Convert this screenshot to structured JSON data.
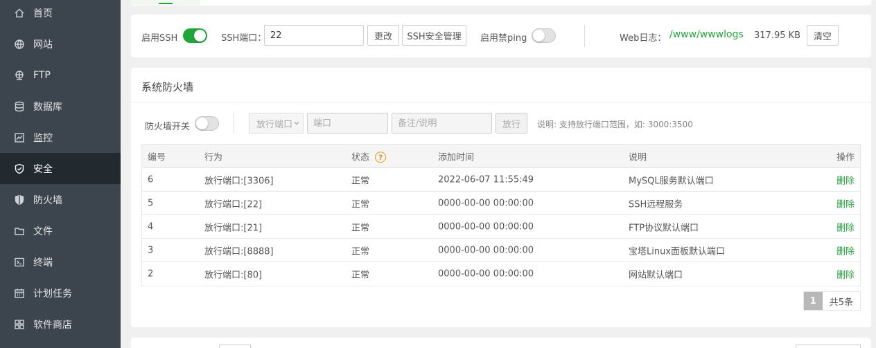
{
  "sidebar": {
    "items": [
      {
        "label": "首页",
        "icon": "home-icon"
      },
      {
        "label": "网站",
        "icon": "globe-icon"
      },
      {
        "label": "FTP",
        "icon": "ftp-icon"
      },
      {
        "label": "数据库",
        "icon": "database-icon"
      },
      {
        "label": "监控",
        "icon": "monitor-icon"
      },
      {
        "label": "安全",
        "icon": "shield-check-icon",
        "active": true
      },
      {
        "label": "防火墙",
        "icon": "shield-icon"
      },
      {
        "label": "文件",
        "icon": "folder-icon"
      },
      {
        "label": "终端",
        "icon": "terminal-icon"
      },
      {
        "label": "计划任务",
        "icon": "calendar-icon"
      },
      {
        "label": "软件商店",
        "icon": "apps-icon"
      }
    ]
  },
  "ssh": {
    "enable_label": "启用SSH",
    "enabled": true,
    "port_label": "SSH端口：",
    "port_value": "22",
    "change_button": "更改",
    "manage_button": "SSH安全管理",
    "ping_label": "启用禁ping",
    "ping_enabled": false,
    "weblog_label": "Web日志：",
    "weblog_path": "/www/wwwlogs",
    "weblog_size": "317.95 KB",
    "clear_button": "清空"
  },
  "firewall": {
    "title": "系统防火墙",
    "switch_label": "防火墙开关",
    "switch_enabled": false,
    "action_select": "放行端口",
    "port_placeholder": "端口",
    "note_placeholder": "备注/说明",
    "allow_button": "放行",
    "hint": "说明: 支持放行端口范围，如: 3000:3500",
    "columns": {
      "id": "编号",
      "action": "行为",
      "status": "状态",
      "added": "添加时间",
      "desc": "说明",
      "op": "操作"
    },
    "rows": [
      {
        "id": "6",
        "action": "放行端口:[3306]",
        "status": "正常",
        "added": "2022-06-07 11:55:49",
        "desc": "MySQL服务默认端口",
        "op": "删除"
      },
      {
        "id": "5",
        "action": "放行端口:[22]",
        "status": "正常",
        "added": "0000-00-00 00:00:00",
        "desc": "SSH远程服务",
        "op": "删除"
      },
      {
        "id": "4",
        "action": "放行端口:[21]",
        "status": "正常",
        "added": "0000-00-00 00:00:00",
        "desc": "FTP协议默认端口",
        "op": "删除"
      },
      {
        "id": "3",
        "action": "放行端口:[8888]",
        "status": "正常",
        "added": "0000-00-00 00:00:00",
        "desc": "宝塔Linux面板默认端口",
        "op": "删除"
      },
      {
        "id": "2",
        "action": "放行端口:[80]",
        "status": "正常",
        "added": "0000-00-00 00:00:00",
        "desc": "网站默认端口",
        "op": "删除"
      }
    ],
    "pager": {
      "current": "1",
      "total": "共5条"
    }
  },
  "colors": {
    "accent": "#20a53a",
    "sidebar_bg": "#3c444d",
    "sidebar_active": "#22292f"
  }
}
